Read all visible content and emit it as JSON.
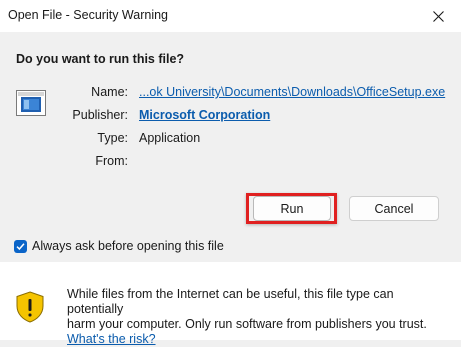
{
  "window": {
    "title": "Open File - Security Warning",
    "close_glyph": "✕"
  },
  "dialog": {
    "question": "Do you want to run this file?",
    "file_icon": "installer-file-icon",
    "fields": {
      "name_label": "Name:",
      "name_value": "...ok University\\Documents\\Downloads\\OfficeSetup.exe",
      "publisher_label": "Publisher:",
      "publisher_value": "Microsoft Corporation",
      "type_label": "Type:",
      "type_value": "Application",
      "from_label": "From:",
      "from_value": ""
    },
    "buttons": {
      "run": "Run",
      "cancel": "Cancel"
    },
    "checkbox": {
      "label": "Always ask before opening this file",
      "checked": true
    }
  },
  "footer": {
    "warning_icon": "shield-warning-icon",
    "message_line1": "While files from the Internet can be useful, this file type can potentially",
    "message_line2": "harm your computer. Only run software from publishers you trust.",
    "link": "What's the risk?"
  },
  "colors": {
    "link": "#0b5cad",
    "checkbox_accent": "#0a64c8",
    "highlight_box": "#e02020",
    "shield_yellow": "#f5c400"
  }
}
